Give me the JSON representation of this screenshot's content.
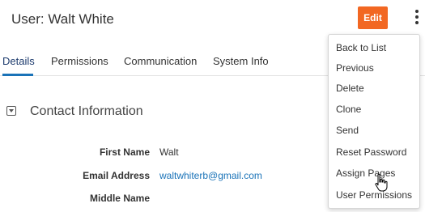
{
  "header": {
    "title": "User: Walt White",
    "edit_label": "Edit"
  },
  "tabs": [
    {
      "label": "Details",
      "active": true
    },
    {
      "label": "Permissions",
      "active": false
    },
    {
      "label": "Communication",
      "active": false
    },
    {
      "label": "System Info",
      "active": false
    }
  ],
  "section": {
    "title": "Contact Information"
  },
  "fields": [
    {
      "label": "First Name",
      "value": "Walt"
    },
    {
      "label": "Email Address",
      "value": "waltwhiterb@gmail.com"
    },
    {
      "label": "Middle Name",
      "value": ""
    }
  ],
  "menu": {
    "items": [
      {
        "label": "Back to List"
      },
      {
        "label": "Previous"
      },
      {
        "label": "Delete"
      },
      {
        "label": "Clone"
      },
      {
        "label": "Send"
      },
      {
        "label": "Reset Password"
      },
      {
        "label": "Assign Pages"
      },
      {
        "label": "User Permissions"
      }
    ]
  },
  "colors": {
    "accent": "#f26722",
    "link": "#1a73b8"
  }
}
